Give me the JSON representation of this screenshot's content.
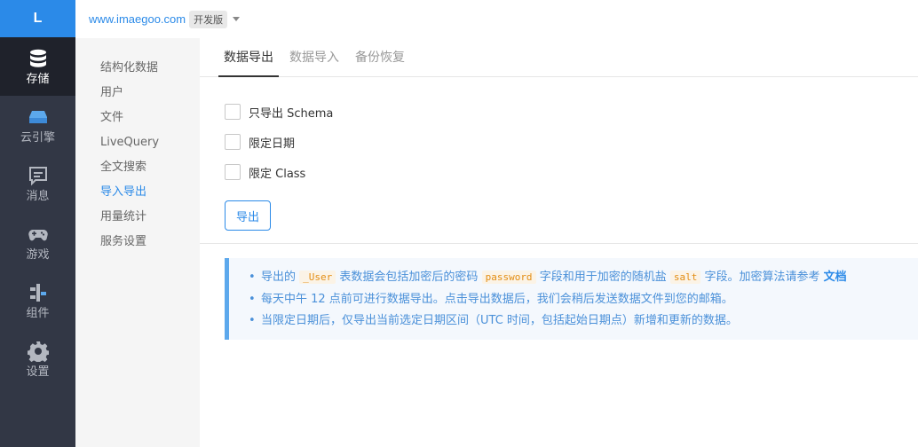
{
  "logo": "L",
  "rail": [
    {
      "label": "存储",
      "icon": "database-icon",
      "active": true
    },
    {
      "label": "云引擎",
      "icon": "cloud-engine-icon"
    },
    {
      "label": "消息",
      "icon": "message-icon"
    },
    {
      "label": "游戏",
      "icon": "gamepad-icon"
    },
    {
      "label": "组件",
      "icon": "components-icon"
    },
    {
      "label": "设置",
      "icon": "gear-icon"
    }
  ],
  "topbar": {
    "domain": "www.imaegoo.com",
    "badge": "开发版"
  },
  "subnav": [
    "结构化数据",
    "用户",
    "文件",
    "LiveQuery",
    "全文搜索",
    "导入导出",
    "用量统计",
    "服务设置"
  ],
  "subnav_active": "导入导出",
  "tabs": [
    "数据导出",
    "数据导入",
    "备份恢复"
  ],
  "tab_active": "数据导出",
  "options": [
    "只导出 Schema",
    "限定日期",
    "限定 Class"
  ],
  "export_label": "导出",
  "notes": {
    "n1_a": "导出的",
    "n1_user": "_User",
    "n1_b": "表数据会包括加密后的密码",
    "n1_password": "password",
    "n1_c": "字段和用于加密的随机盐",
    "n1_salt": "salt",
    "n1_d": "字段。加密算法请参考",
    "n1_link": "文档",
    "n2": "每天中午 12 点前可进行数据导出。点击导出数据后，我们会稍后发送数据文件到您的邮箱。",
    "n3": "当限定日期后，仅导出当前选定日期区间（UTC 时间，包括起始日期点）新增和更新的数据。"
  },
  "colors": {
    "accent": "#2b8ae8",
    "rail_bg": "#323745",
    "rail_active_bg": "#1f222b",
    "code": "#e38d13"
  }
}
